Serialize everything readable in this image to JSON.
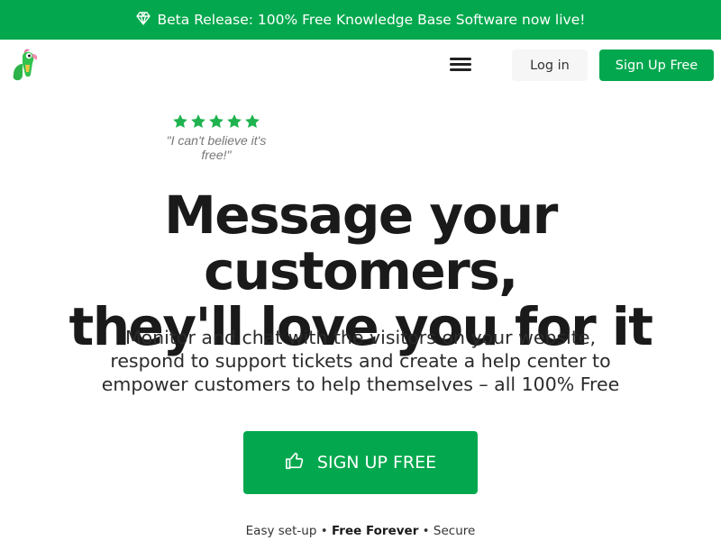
{
  "banner": {
    "icon": "diamond-icon",
    "text": "Beta Release: 100% Free Knowledge Base Software now live!"
  },
  "nav": {
    "logo": "parrot-logo",
    "menu_icon": "hamburger-menu-icon",
    "login_label": "Log in",
    "signup_label": "Sign Up Free"
  },
  "rating": {
    "stars": 5,
    "quote_line1": "\"I can't believe it's",
    "quote_line2": "free!\""
  },
  "hero": {
    "headline_line1": "Message your customers,",
    "headline_line2": "they'll love you for it",
    "sub_line1": "Monitor and chat with the visitors on your website,",
    "sub_line2": "respond to support tickets and create a help center to",
    "sub_line3": "empower customers to help themselves – all 100% Free"
  },
  "cta": {
    "icon": "thumbs-up-icon",
    "label": "SIGN UP FREE"
  },
  "features": {
    "item1": "Easy set-up",
    "sep": "•",
    "item2": "Free Forever",
    "item3": "Secure"
  },
  "colors": {
    "brand_green": "#03a84e",
    "star_green": "#1fb34f",
    "text_dark": "#1a1a1a"
  }
}
